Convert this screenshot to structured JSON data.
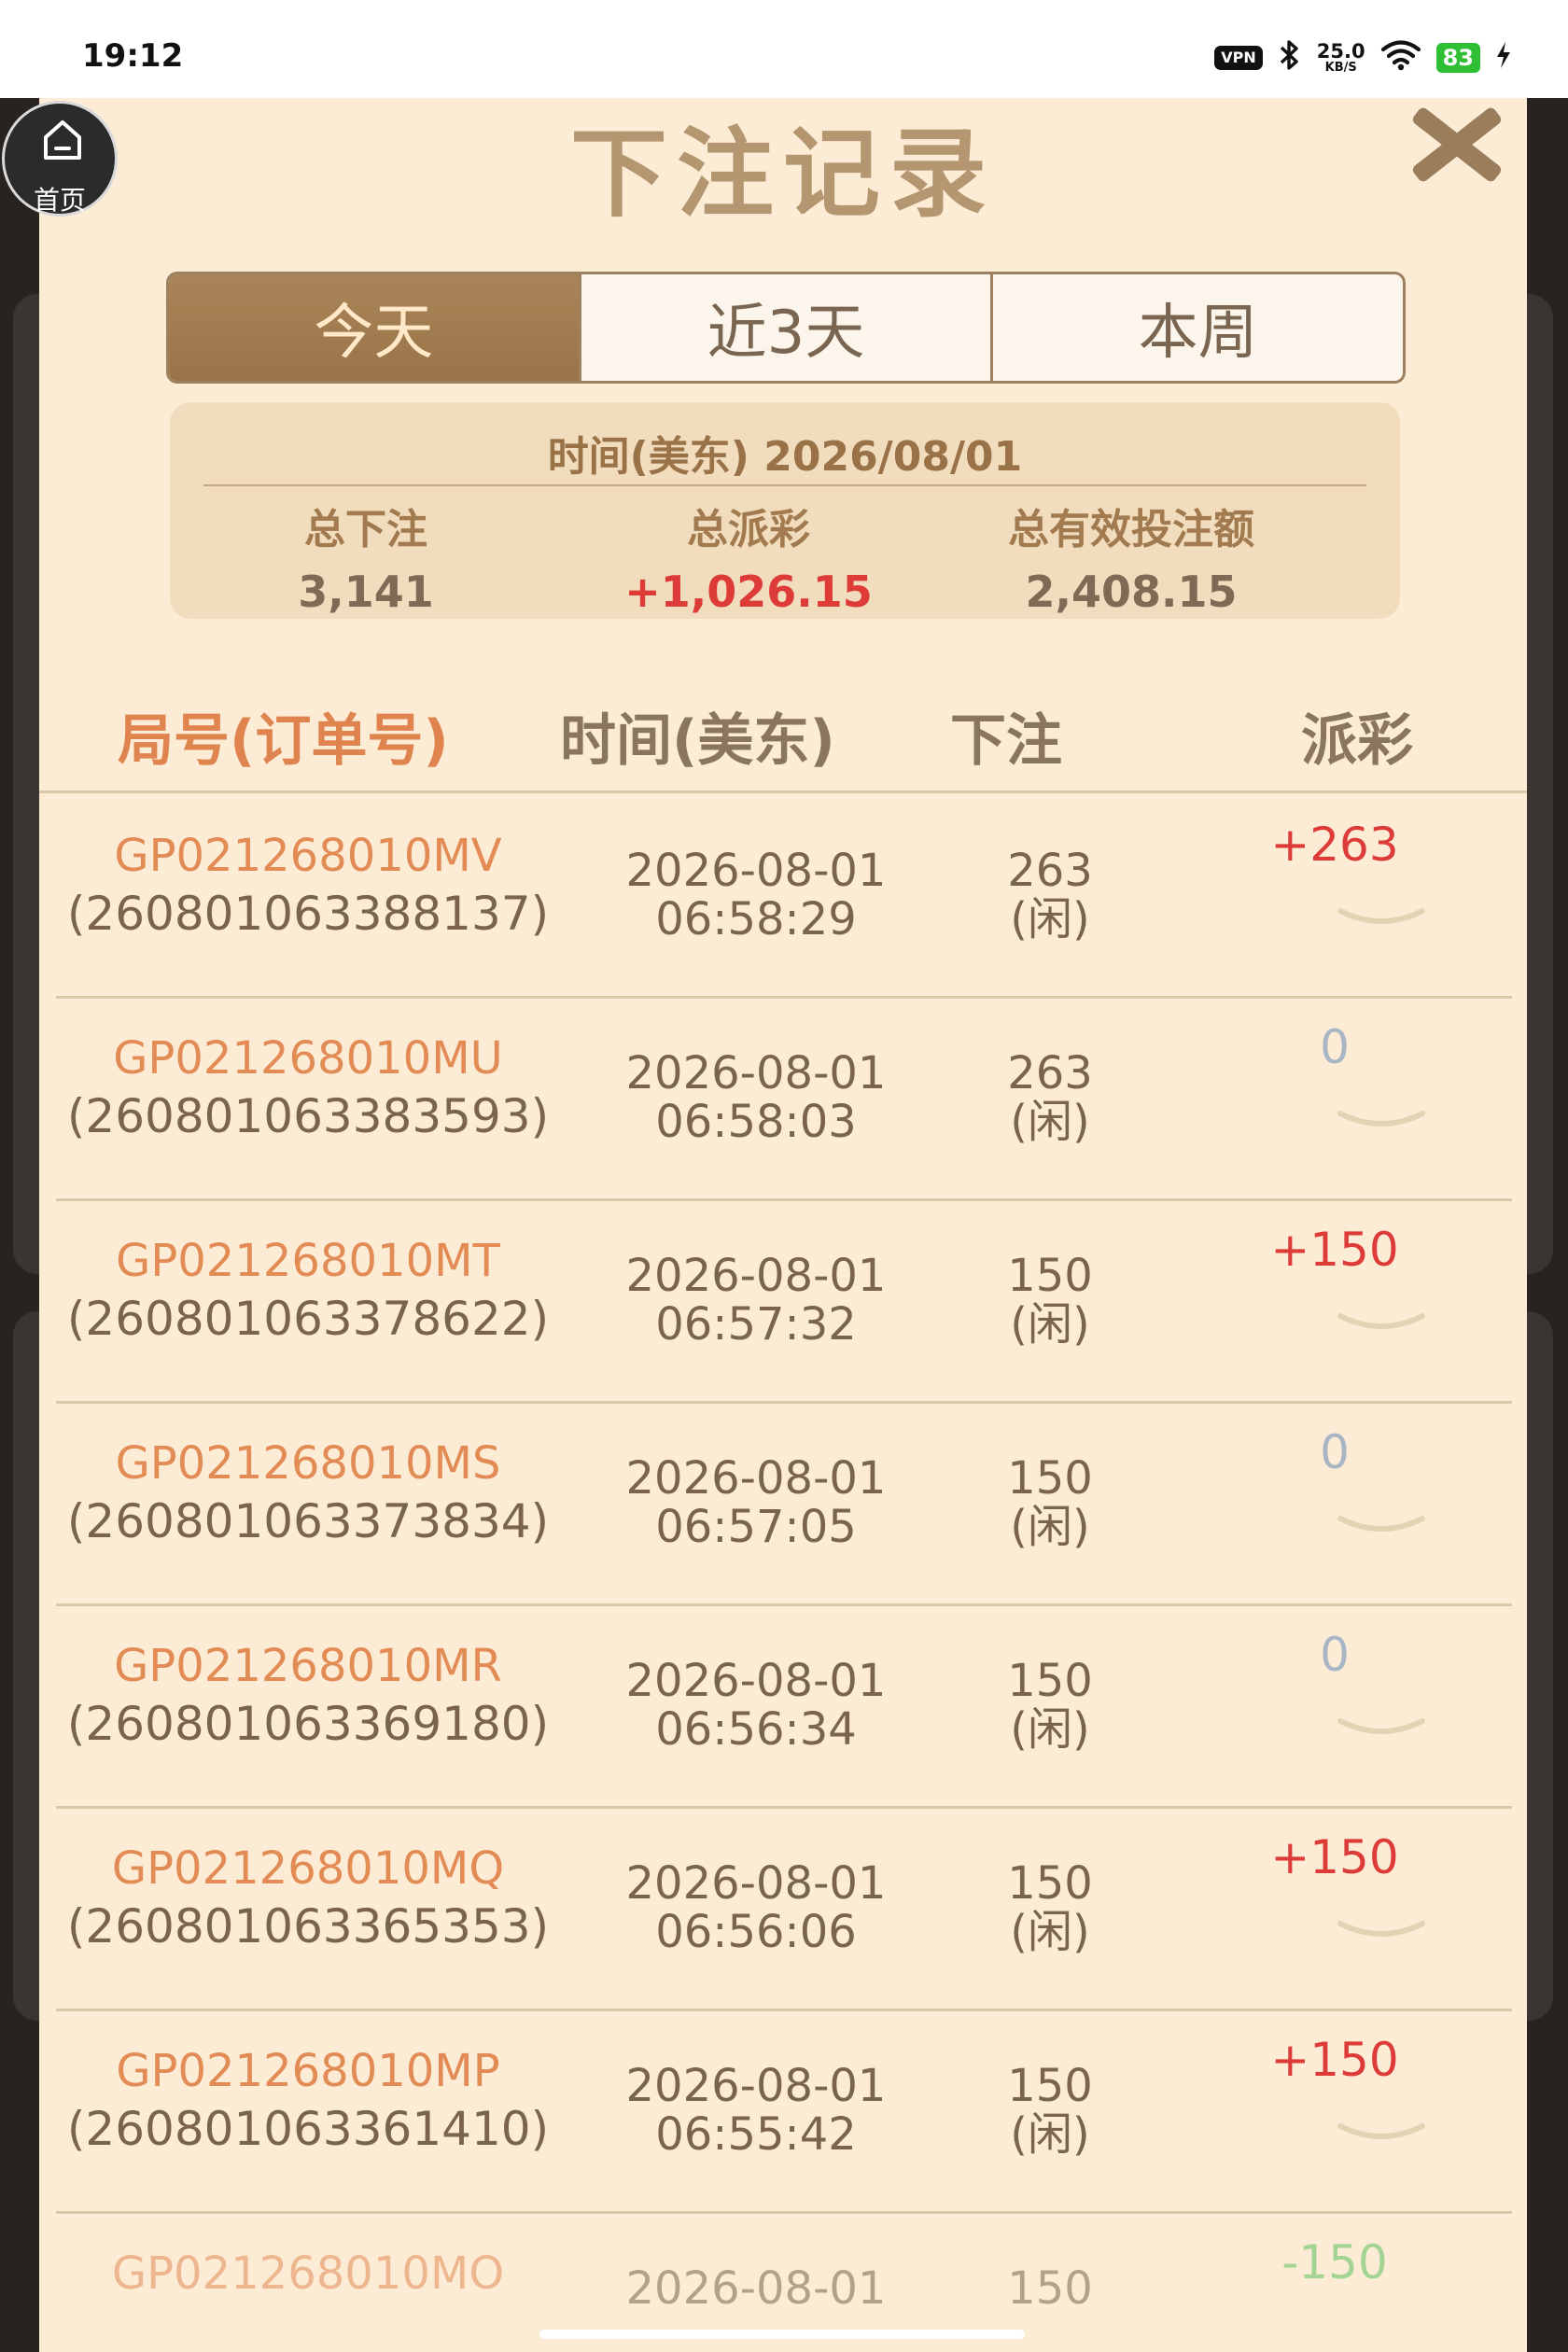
{
  "status_bar": {
    "time": "19:12",
    "vpn": "VPN",
    "network_speed": "25.0",
    "network_unit": "KB/S",
    "battery": "83",
    "icons": [
      "bluetooth-icon",
      "wifi-icon",
      "charging-icon"
    ]
  },
  "home_button": {
    "label": "首页",
    "icon": "home-icon"
  },
  "modal": {
    "title": "下注记录",
    "close_icon": "close-icon",
    "tabs": [
      {
        "label": "今天",
        "active": true
      },
      {
        "label": "近3天",
        "active": false
      },
      {
        "label": "本周",
        "active": false
      }
    ],
    "summary": {
      "date_line": "时间(美东) 2026/08/01",
      "stats": [
        {
          "label": "总下注",
          "value": "3,141"
        },
        {
          "label": "总派彩",
          "value": "+1,026.15"
        },
        {
          "label": "总有效投注额",
          "value": "2,408.15"
        }
      ]
    },
    "table": {
      "headers": [
        "局号(订单号)",
        "时间(美东)",
        "下注",
        "派彩"
      ],
      "rows": [
        {
          "round": "GP021268010MV",
          "order": "(260801063388137)",
          "date": "2026-08-01",
          "time": "06:58:29",
          "bet": "263",
          "bet_side": "(闲)",
          "payout": "+263",
          "payout_type": "pos"
        },
        {
          "round": "GP021268010MU",
          "order": "(260801063383593)",
          "date": "2026-08-01",
          "time": "06:58:03",
          "bet": "263",
          "bet_side": "(闲)",
          "payout": "0",
          "payout_type": "zero"
        },
        {
          "round": "GP021268010MT",
          "order": "(260801063378622)",
          "date": "2026-08-01",
          "time": "06:57:32",
          "bet": "150",
          "bet_side": "(闲)",
          "payout": "+150",
          "payout_type": "pos"
        },
        {
          "round": "GP021268010MS",
          "order": "(260801063373834)",
          "date": "2026-08-01",
          "time": "06:57:05",
          "bet": "150",
          "bet_side": "(闲)",
          "payout": "0",
          "payout_type": "zero"
        },
        {
          "round": "GP021268010MR",
          "order": "(260801063369180)",
          "date": "2026-08-01",
          "time": "06:56:34",
          "bet": "150",
          "bet_side": "(闲)",
          "payout": "0",
          "payout_type": "zero"
        },
        {
          "round": "GP021268010MQ",
          "order": "(260801063365353)",
          "date": "2026-08-01",
          "time": "06:56:06",
          "bet": "150",
          "bet_side": "(闲)",
          "payout": "+150",
          "payout_type": "pos"
        },
        {
          "round": "GP021268010MP",
          "order": "(260801063361410)",
          "date": "2026-08-01",
          "time": "06:55:42",
          "bet": "150",
          "bet_side": "(闲)",
          "payout": "+150",
          "payout_type": "pos"
        },
        {
          "round": "GP021268010MO",
          "order": "",
          "date": "2026-08-01",
          "time": "",
          "bet": "150",
          "bet_side": "",
          "payout": "-150",
          "payout_type": "neg"
        }
      ]
    }
  },
  "colors": {
    "modal_bg": "#fcecd6",
    "accent_brown": "#9a7448",
    "positive": "#dd3b37",
    "zero": "#a8b5c5",
    "negative": "#5cc25d",
    "round_id": "#e38b55"
  }
}
